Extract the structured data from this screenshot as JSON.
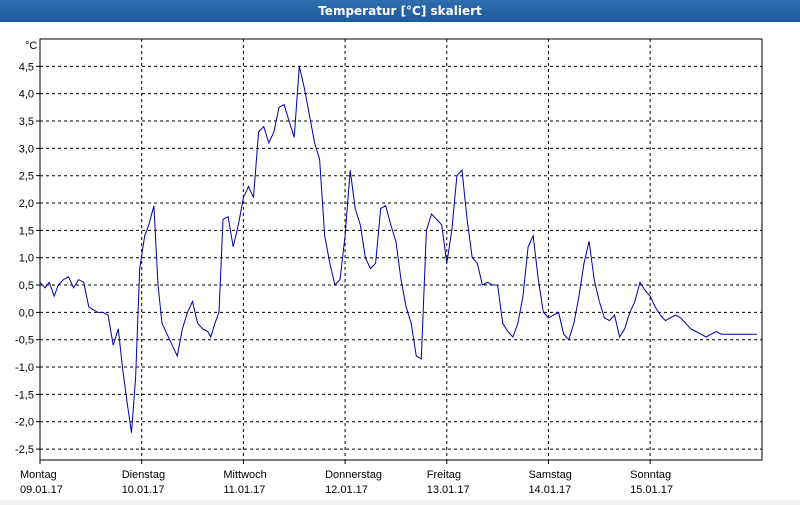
{
  "window": {
    "title": "Temperatur [°C] skaliert"
  },
  "chart_data": {
    "type": "line",
    "title": "Temperatur [°C] skaliert",
    "unit": "°C",
    "ylim": [
      -2.7,
      5.0
    ],
    "yticks": [
      4.5,
      4.0,
      3.5,
      3.0,
      2.5,
      2.0,
      1.5,
      1.0,
      0.5,
      0.0,
      -0.5,
      -1.0,
      -1.5,
      -2.0,
      -2.5
    ],
    "ytick_labels": [
      "4,5",
      "4,0",
      "3,5",
      "3,0",
      "2,5",
      "2,0",
      "1,5",
      "1,0",
      "0,5",
      "0,0",
      "-0,5",
      "-1,0",
      "-1,5",
      "-2,0",
      "-2,5"
    ],
    "xlim": [
      0,
      7.1
    ],
    "xticks": [
      {
        "day": "Montag",
        "date": "09.01.17"
      },
      {
        "day": "Dienstag",
        "date": "10.01.17"
      },
      {
        "day": "Mittwoch",
        "date": "11.01.17"
      },
      {
        "day": "Donnerstag",
        "date": "12.01.17"
      },
      {
        "day": "Freitag",
        "date": "13.01.17"
      },
      {
        "day": "Samstag",
        "date": "14.01.17"
      },
      {
        "day": "Sonntag",
        "date": "15.01.17"
      }
    ],
    "grid": true,
    "color": "#0000aa",
    "x": [
      0.0,
      0.05,
      0.09,
      0.14,
      0.18,
      0.23,
      0.28,
      0.33,
      0.38,
      0.43,
      0.48,
      0.52,
      0.57,
      0.62,
      0.67,
      0.72,
      0.77,
      0.81,
      0.86,
      0.9,
      0.94,
      0.98,
      1.03,
      1.07,
      1.12,
      1.16,
      1.2,
      1.25,
      1.3,
      1.35,
      1.4,
      1.45,
      1.5,
      1.55,
      1.6,
      1.65,
      1.68,
      1.72,
      1.76,
      1.8,
      1.85,
      1.9,
      1.95,
      2.0,
      2.05,
      2.1,
      2.15,
      2.2,
      2.25,
      2.3,
      2.35,
      2.4,
      2.45,
      2.5,
      2.55,
      2.6,
      2.65,
      2.7,
      2.75,
      2.8,
      2.85,
      2.9,
      2.95,
      3.0,
      3.05,
      3.1,
      3.15,
      3.2,
      3.25,
      3.3,
      3.35,
      3.4,
      3.45,
      3.5,
      3.55,
      3.6,
      3.65,
      3.7,
      3.75,
      3.8,
      3.85,
      3.9,
      3.95,
      4.0,
      4.05,
      4.1,
      4.15,
      4.2,
      4.25,
      4.3,
      4.35,
      4.4,
      4.45,
      4.5,
      4.55,
      4.6,
      4.65,
      4.7,
      4.75,
      4.8,
      4.85,
      4.9,
      4.95,
      5.0,
      5.05,
      5.1,
      5.15,
      5.2,
      5.25,
      5.3,
      5.35,
      5.4,
      5.45,
      5.5,
      5.55,
      5.6,
      5.65,
      5.7,
      5.75,
      5.8,
      5.85,
      5.9,
      5.95,
      6.0,
      6.05,
      6.1,
      6.15,
      6.2,
      6.25,
      6.3,
      6.35,
      6.4,
      6.45,
      6.5,
      6.55,
      6.6,
      6.65,
      6.7,
      6.75,
      6.8,
      6.85,
      6.9,
      6.95,
      7.0,
      7.05
    ],
    "y": [
      0.55,
      0.45,
      0.55,
      0.3,
      0.5,
      0.6,
      0.65,
      0.45,
      0.6,
      0.55,
      0.1,
      0.05,
      0.0,
      0.0,
      -0.05,
      -0.6,
      -0.3,
      -1.0,
      -1.7,
      -2.2,
      -1.2,
      0.8,
      1.4,
      1.6,
      1.95,
      0.5,
      -0.2,
      -0.4,
      -0.6,
      -0.8,
      -0.3,
      0.0,
      0.2,
      -0.2,
      -0.3,
      -0.35,
      -0.45,
      -0.2,
      0.0,
      1.7,
      1.75,
      1.2,
      1.6,
      2.1,
      2.3,
      2.1,
      3.3,
      3.4,
      3.1,
      3.3,
      3.75,
      3.8,
      3.5,
      3.2,
      4.5,
      4.1,
      3.6,
      3.1,
      2.8,
      1.4,
      0.9,
      0.5,
      0.6,
      1.4,
      2.6,
      1.9,
      1.6,
      1.0,
      0.8,
      0.9,
      1.9,
      1.95,
      1.6,
      1.3,
      0.6,
      0.1,
      -0.2,
      -0.8,
      -0.85,
      1.5,
      1.8,
      1.7,
      1.6,
      0.9,
      1.5,
      2.5,
      2.6,
      1.7,
      1.0,
      0.9,
      0.5,
      0.55,
      0.5,
      0.5,
      -0.2,
      -0.35,
      -0.45,
      -0.2,
      0.3,
      1.2,
      1.4,
      0.6,
      0.0,
      -0.1,
      -0.05,
      0.0,
      -0.4,
      -0.5,
      -0.2,
      0.3,
      0.9,
      1.3,
      0.6,
      0.2,
      -0.1,
      -0.15,
      -0.05,
      -0.45,
      -0.3,
      0.0,
      0.2,
      0.55,
      0.4,
      0.3,
      0.1,
      -0.05,
      -0.15,
      -0.1,
      -0.05,
      -0.1,
      -0.2,
      -0.3,
      -0.35,
      -0.4,
      -0.45,
      -0.4,
      -0.35,
      -0.4,
      -0.4,
      -0.4,
      -0.4,
      -0.4,
      -0.4,
      -0.4,
      -0.4
    ]
  }
}
